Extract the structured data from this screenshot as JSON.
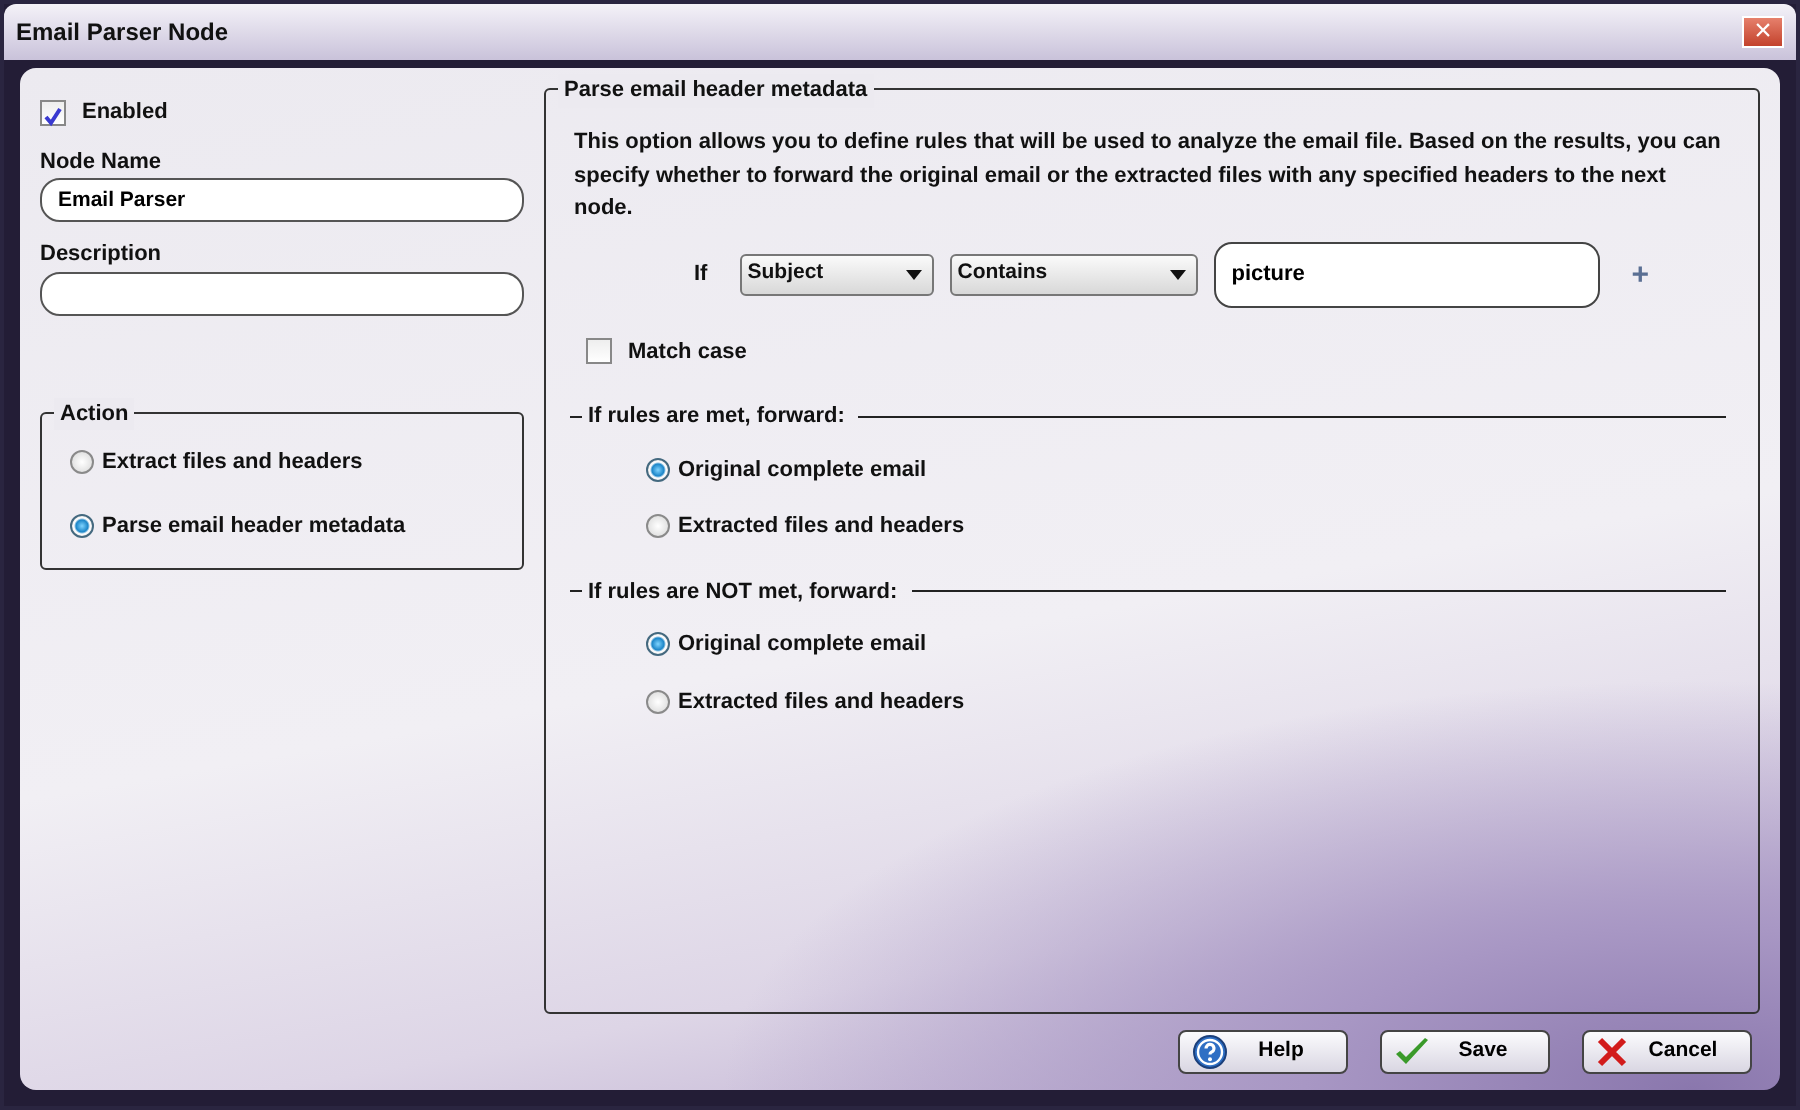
{
  "window": {
    "title": "Email Parser Node",
    "close": "×"
  },
  "enabled": {
    "label": "Enabled",
    "checked": true
  },
  "fields": [
    {
      "label": "Node Name",
      "value": "Email Parser"
    },
    {
      "label": "Description"
    }
  ],
  "action": {
    "title": "Action",
    "options": [
      {
        "label": "Extract files and headers",
        "selected": false
      },
      {
        "label": "Parse email header metadata",
        "selected": true
      }
    ]
  },
  "parse_group": {
    "title": "Parse email header metadata",
    "description": "This option allows you to define rules that will be used to analyze the email file. Based on the results, you can specify whether to forward the original email or the extracted files with any specified headers to the next node.",
    "rule": {
      "if_label": "If",
      "field": "Subject",
      "operator": "Contains",
      "value": "picture",
      "add": "+"
    },
    "match_case": {
      "label": "Match case",
      "checked": false
    },
    "sections": [
      {
        "title": "If rules are met, forward:",
        "options": [
          {
            "label": "Original complete email",
            "selected": true
          },
          {
            "label": "Extracted files and headers",
            "selected": false
          }
        ]
      },
      {
        "title": "If rules are NOT met, forward:",
        "options": [
          {
            "label": "Original complete email",
            "selected": true
          },
          {
            "label": "Extracted files and headers",
            "selected": false
          }
        ]
      }
    ]
  },
  "buttons": [
    {
      "label": "Help",
      "kind": "help"
    },
    {
      "label": "Save",
      "kind": "save"
    },
    {
      "label": "Cancel",
      "kind": "cancel"
    }
  ]
}
